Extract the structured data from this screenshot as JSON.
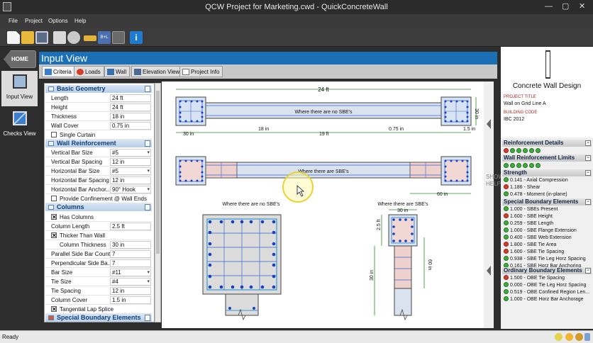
{
  "window": {
    "title": "QCW Project for Marketing.cwd - QuickConcreteWall"
  },
  "menu": {
    "items": [
      "File",
      "Project",
      "Options",
      "Help"
    ]
  },
  "toolbar": {
    "icons": [
      "new-file-icon",
      "open-folder-icon",
      "save-icon",
      "print-icon",
      "print-preview-icon",
      "ruler-icon",
      "dimension-icon",
      "calculator-icon",
      "info-icon"
    ]
  },
  "nav": {
    "home": "HOME",
    "input_view": "Input View",
    "checks_view": "Checks View"
  },
  "input_view": {
    "title": "Input View",
    "tabs": [
      "Criteria",
      "Loads",
      "Wall",
      "Elevation View",
      "Project Info"
    ]
  },
  "panel": {
    "basic_geometry": {
      "title": "Basic Geometry",
      "rows": [
        {
          "label": "Length",
          "value": "24 ft"
        },
        {
          "label": "Height",
          "value": "24 ft"
        },
        {
          "label": "Thickness",
          "value": "18 in"
        },
        {
          "label": "Wall Cover",
          "value": "0.75 in"
        }
      ],
      "single_curtain": "Single Curtain"
    },
    "wall_reinforcement": {
      "title": "Wall Reinforcement",
      "rows": [
        {
          "label": "Vertical Bar Size",
          "value": "#5"
        },
        {
          "label": "Vertical Bar Spacing",
          "value": "12 in"
        },
        {
          "label": "Horizontal Bar Size",
          "value": "#5"
        },
        {
          "label": "Horizontal Bar Spacing",
          "value": "12 in"
        },
        {
          "label": "Horizontal Bar Anchor...",
          "value": "90° Hook"
        }
      ],
      "provide_confinement": "Provide Confinement @ Wall Ends"
    },
    "columns": {
      "title": "Columns",
      "has_columns": "Has Columns",
      "column_length": {
        "label": "Column Length",
        "value": "2.5 ft"
      },
      "thicker_than_wall": "Thicker Than Wall",
      "column_thickness": {
        "label": "Column Thickness",
        "value": "30 in"
      },
      "rows": [
        {
          "label": "Parallel Side Bar Count",
          "value": "7"
        },
        {
          "label": "Perpendicular Side Ba...",
          "value": "7"
        },
        {
          "label": "Bar Size",
          "value": "#11"
        },
        {
          "label": "Tie Size",
          "value": "#4"
        },
        {
          "label": "Tie Spacing",
          "value": "12 in"
        },
        {
          "label": "Column Cover",
          "value": "1.5 in"
        }
      ],
      "tangential_lap": "Tangential Lap Splice"
    },
    "special_boundary": {
      "title": "Special Boundary Elements"
    }
  },
  "drawing": {
    "dim_24ft": "24 ft",
    "label_no_sbe": "Where there are no SBE's",
    "label_sbe": "Where there are SBE's",
    "dim_30in": "30 in",
    "dim_18in": "18 in",
    "dim_19ft": "19 ft",
    "dim_075in": "0.75 in",
    "dim_15in": "1.5 in",
    "dim_60in": "60 in",
    "dim_25ft": "2.5 ft",
    "show_help": "SHOW HELP"
  },
  "right_panel": {
    "title": "Concrete Wall Design",
    "project_title_caption": "PROJECT TITLE",
    "project_title": "Wall on Grid Line A",
    "building_code_caption": "BUILDING CODE",
    "building_code": "IBC 2012",
    "reinforcement_details": "Reinforcement Details",
    "wall_reinforcement_limits": "Wall Reinforcement Limits",
    "strength": {
      "title": "Strength",
      "items": [
        {
          "text": "0.141 - Axial Compression",
          "status": "g"
        },
        {
          "text": "1.186 - Shear",
          "status": "r"
        },
        {
          "text": "0.478 - Moment (in-plane)",
          "status": "g"
        }
      ]
    },
    "sbe": {
      "title": "Special Boundary Elements",
      "items": [
        {
          "text": "1.000 - SBEs Present",
          "status": "g"
        },
        {
          "text": "1.600 - SBE Height",
          "status": "r"
        },
        {
          "text": "0.259 - SBE Length",
          "status": "g"
        },
        {
          "text": "1.000 - SBE Flange Extension",
          "status": "g"
        },
        {
          "text": "0.400 - SBE Web Extension",
          "status": "g"
        },
        {
          "text": "1.800 - SBE Tie Area",
          "status": "r"
        },
        {
          "text": "1.600 - SBE Tie Spacing",
          "status": "r"
        },
        {
          "text": "0.938 - SBE Tie Leg Horz Spacing",
          "status": "g"
        },
        {
          "text": "0.161 - SBE Horz Bar Anchoring",
          "status": "g"
        }
      ]
    },
    "obe": {
      "title": "Ordinary Boundary Elements",
      "items": [
        {
          "text": "1.500 - OBE Tie Spacing",
          "status": "r"
        },
        {
          "text": "0.000 - OBE Tie Leg Horz Spacing",
          "status": "g"
        },
        {
          "text": "0.519 - OBE Confined Region Len...",
          "status": "g"
        },
        {
          "text": "1.000 - OBE Horz Bar Anchorage",
          "status": "g"
        }
      ]
    }
  },
  "status": {
    "text": "Ready"
  }
}
